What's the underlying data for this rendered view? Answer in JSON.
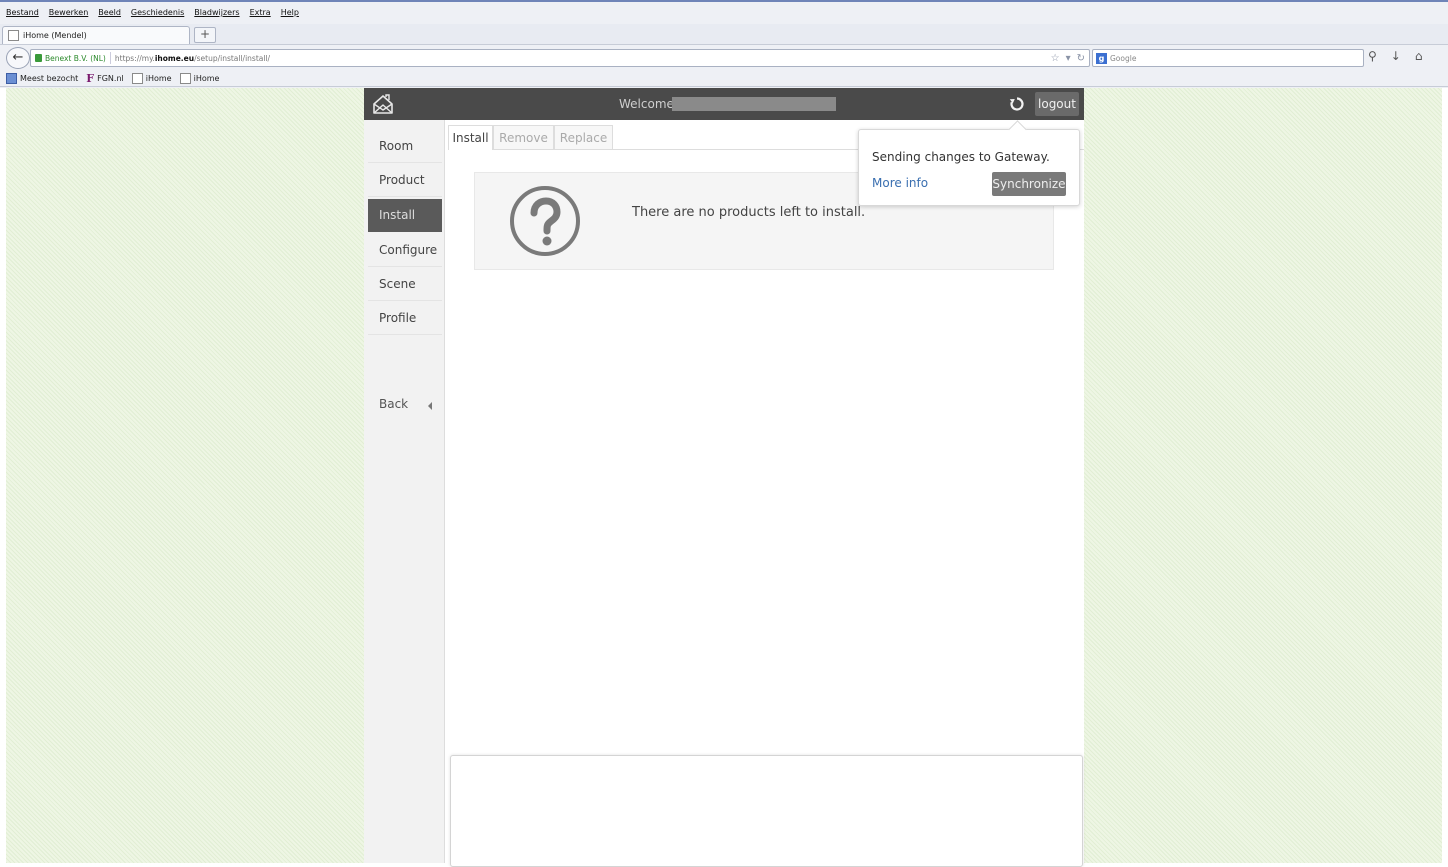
{
  "browser": {
    "menu": [
      "Bestand",
      "Bewerken",
      "Beeld",
      "Geschiedenis",
      "Bladwijzers",
      "Extra",
      "Help"
    ],
    "tab_title": "iHome (Mendel)",
    "new_tab": "+",
    "identity": "Benext B.V. (NL)",
    "url_prefix": "https://my.",
    "url_domain": "ihome.eu",
    "url_path": "/setup/install/install/",
    "search_placeholder": "Google",
    "bookmarks": [
      "Meest bezocht",
      "FGN.nl",
      "iHome",
      "iHome"
    ]
  },
  "header": {
    "welcome": "Welcome",
    "logout": "logout"
  },
  "sidebar": {
    "items": [
      {
        "label": "Room"
      },
      {
        "label": "Product"
      },
      {
        "label": "Install"
      },
      {
        "label": "Configure"
      },
      {
        "label": "Scene"
      },
      {
        "label": "Profile"
      }
    ],
    "active": "Install",
    "back": "Back"
  },
  "tabs": [
    {
      "label": "Install"
    },
    {
      "label": "Remove"
    },
    {
      "label": "Replace"
    }
  ],
  "empty_message": "There are no products left to install.",
  "popover": {
    "message": "Sending changes to Gateway.",
    "link": "More info",
    "button": "Synchronize"
  },
  "colors": {
    "header_bg": "#4a4a4a",
    "page_bg": "#eef6e4",
    "link": "#3a6fb0"
  }
}
